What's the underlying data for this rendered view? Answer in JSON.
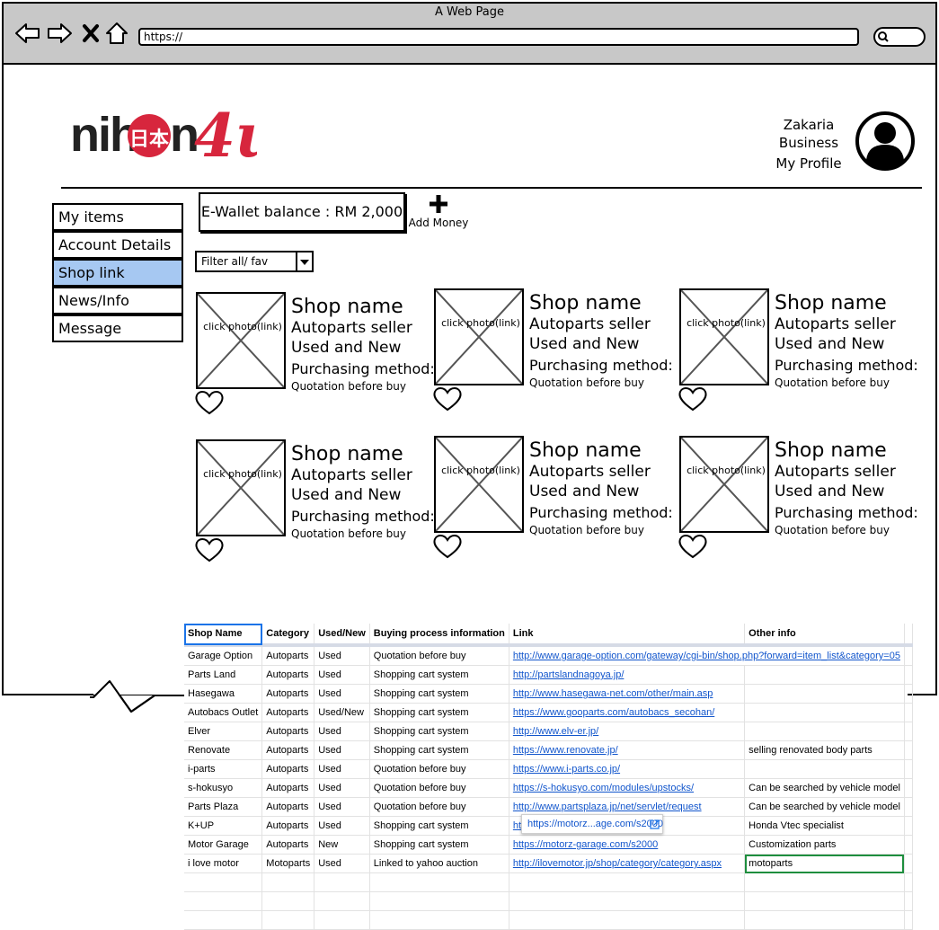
{
  "browser": {
    "title": "A Web Page",
    "url": "https://"
  },
  "header": {
    "user_name": "Zakaria",
    "user_role": "Business",
    "profile_link": "My Profile"
  },
  "sidebar": {
    "items": [
      {
        "label": "My items"
      },
      {
        "label": "Account Details"
      },
      {
        "label": "Shop link",
        "active": true
      },
      {
        "label": "News/Info"
      },
      {
        "label": "Message"
      }
    ]
  },
  "wallet": {
    "label": "E-Wallet balance : RM 2,000",
    "add_money": "Add Money"
  },
  "filter": {
    "selected": "Filter all/ fav"
  },
  "shops": [
    {
      "photo": "click photo(link)",
      "name": "Shop name",
      "line1": "Autoparts seller",
      "line2": "Used and New",
      "line3": "Purchasing method:",
      "line4": "Quotation before buy"
    },
    {
      "photo": "click photo(link)",
      "name": "Shop name",
      "line1": "Autoparts seller",
      "line2": "Used and New",
      "line3": "Purchasing method:",
      "line4": "Quotation before buy"
    },
    {
      "photo": "click photo(link)",
      "name": "Shop name",
      "line1": "Autoparts seller",
      "line2": "Used and New",
      "line3": "Purchasing method:",
      "line4": "Quotation before buy"
    },
    {
      "photo": "click photo(link)",
      "name": "Shop name",
      "line1": "Autoparts seller",
      "line2": "Used and New",
      "line3": "Purchasing method:",
      "line4": "Quotation before buy"
    },
    {
      "photo": "click photo(link)",
      "name": "Shop name",
      "line1": "Autoparts seller",
      "line2": "Used and New",
      "line3": "Purchasing method:",
      "line4": "Quotation before buy"
    },
    {
      "photo": "click photo(link)",
      "name": "Shop name",
      "line1": "Autoparts seller",
      "line2": "Used and New",
      "line3": "Purchasing method:",
      "line4": "Quotation before buy"
    }
  ],
  "sheet": {
    "headers": [
      "Shop Name",
      "Category",
      "Used/New",
      "Buying process information",
      "Link",
      "Other info"
    ],
    "rows": [
      [
        "Garage Option",
        "Autoparts",
        "Used",
        "Quotation before buy",
        "http://www.garage-option.com/gateway/cgi-bin/shop.php?forward=item_list&category=05",
        ""
      ],
      [
        "Parts Land",
        "Autoparts",
        "Used",
        "Shopping cart system",
        "http://partslandnagoya.jp/",
        ""
      ],
      [
        "Hasegawa",
        "Autoparts",
        "Used",
        "Shopping cart system",
        "http://www.hasegawa-net.com/other/main.asp",
        ""
      ],
      [
        "Autobacs Outlet",
        "Autoparts",
        "Used/New",
        "Shopping cart system",
        "https://www.gooparts.com/autobacs_secohan/",
        ""
      ],
      [
        "Elver",
        "Autoparts",
        "Used",
        "Shopping cart system",
        "http://www.elv-er.jp/",
        ""
      ],
      [
        "Renovate",
        "Autoparts",
        "Used",
        "Shopping cart system",
        "https://www.renovate.jp/",
        "selling renovated body parts"
      ],
      [
        "i-parts",
        "Autoparts",
        "Used",
        "Quotation before buy",
        "https://www.i-parts.co.jp/",
        ""
      ],
      [
        "s-hokusyo",
        "Autoparts",
        "Used",
        "Quotation before buy",
        "https://s-hokusyo.com/modules/upstocks/",
        "Can be searched by vehicle model"
      ],
      [
        "Parts Plaza",
        "Autoparts",
        "Used",
        "Quotation before buy",
        "http://www.partsplaza.jp/net/servlet/request",
        "Can be searched by vehicle model"
      ],
      [
        "K+UP",
        "Autoparts",
        "Used",
        "Shopping cart system",
        "ht",
        "Honda Vtec specialist"
      ],
      [
        "Motor Garage",
        "Autoparts",
        "New",
        "Shopping cart system",
        "https://motorz-garage.com/s2000",
        "Customization parts"
      ],
      [
        "i love motor",
        "Motoparts",
        "Used",
        "Linked to yahoo auction",
        "http://ilovemotor.jp/shop/category/category.aspx",
        "motoparts"
      ]
    ],
    "tooltip": "https://motorz...age.com/s2000"
  },
  "colors": {
    "active_sidebar": "#a6c8f2",
    "titlebar": "#c8c8c8",
    "link": "#1155cc",
    "logo_red": "#d7263d"
  },
  "icons": [
    "back-arrow-icon",
    "forward-arrow-icon",
    "close-icon",
    "home-icon",
    "search-icon",
    "plus-icon",
    "heart-icon",
    "user-avatar-icon",
    "external-link-icon"
  ]
}
